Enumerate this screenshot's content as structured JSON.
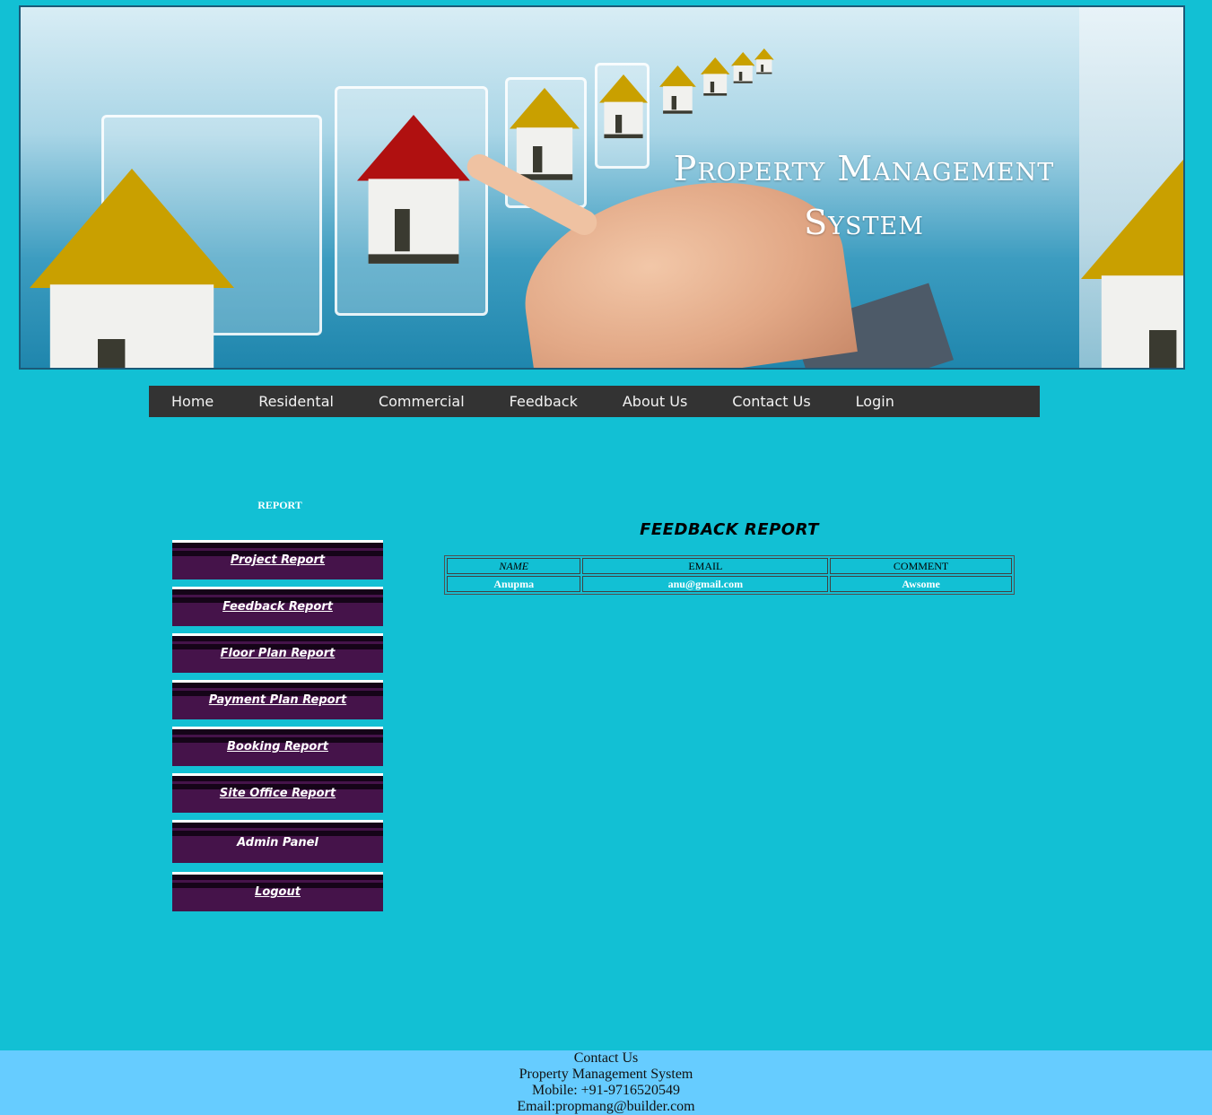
{
  "banner": {
    "title_line1": "Property Management",
    "title_line2": "System"
  },
  "nav": {
    "items": [
      "Home",
      "Residental",
      "Commercial",
      "Feedback",
      "About Us",
      "Contact Us",
      "Login"
    ]
  },
  "sidebar": {
    "title": "REPORT",
    "items": [
      "Project Report",
      "Feedback Report",
      "Floor Plan Report",
      "Payment Plan Report",
      "Booking Report",
      "Site Office Report",
      "Admin Panel",
      "Logout"
    ]
  },
  "report": {
    "title": "FEEDBACK REPORT",
    "columns": [
      "NAME",
      "EMAIL",
      "COMMENT"
    ],
    "rows": [
      [
        "Anupma",
        "anu@gmail.com",
        "Awsome"
      ]
    ]
  },
  "footer": {
    "line1": "Contact Us",
    "line2": "Property Management System",
    "line3": "Mobile: +91-9716520549",
    "line4": "Email:propmang@builder.com"
  }
}
